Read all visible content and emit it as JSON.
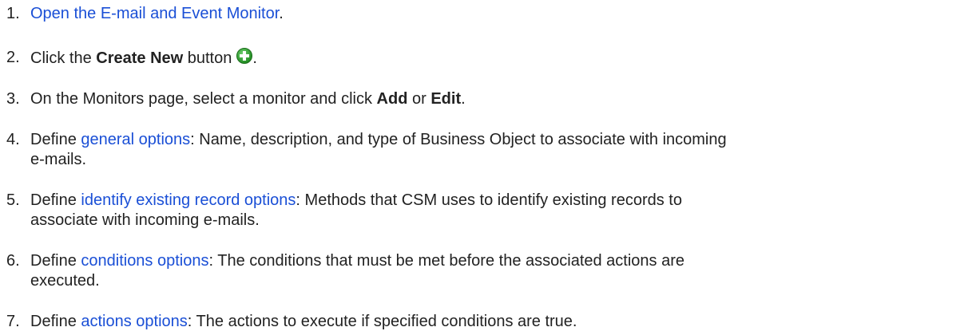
{
  "steps": [
    {
      "number": "1.",
      "link": "Open the E-mail and Event Monitor",
      "after": "."
    },
    {
      "number": "2.",
      "before": "Click the ",
      "bold": "Create New",
      "after_bold": " button",
      "icon": "plus-circle-icon",
      "after": "."
    },
    {
      "number": "3.",
      "before": "On the Monitors page, select a monitor and click ",
      "bold1": "Add",
      "middle": " or ",
      "bold2": "Edit",
      "after": "."
    },
    {
      "number": "4.",
      "before": "Define ",
      "link": "general options",
      "after_line1": ": Name, description, and type of Business Object to associate with incoming",
      "line2": "e-mails."
    },
    {
      "number": "5.",
      "before": "Define ",
      "link": "identify existing record options",
      "after_line1": ": Methods that CSM uses to identify existing records to",
      "line2": "associate with incoming e-mails."
    },
    {
      "number": "6.",
      "before": "Define ",
      "link": "conditions options",
      "after_line1": ": The conditions that must be met before the associated actions are",
      "line2": "executed."
    },
    {
      "number": "7.",
      "before": "Define ",
      "link": "actions options",
      "after": ": The actions to execute if specified conditions are true."
    }
  ],
  "colors": {
    "text": "#222222",
    "link": "#1a4fd6",
    "icon_fill": "#2e9e2e"
  }
}
